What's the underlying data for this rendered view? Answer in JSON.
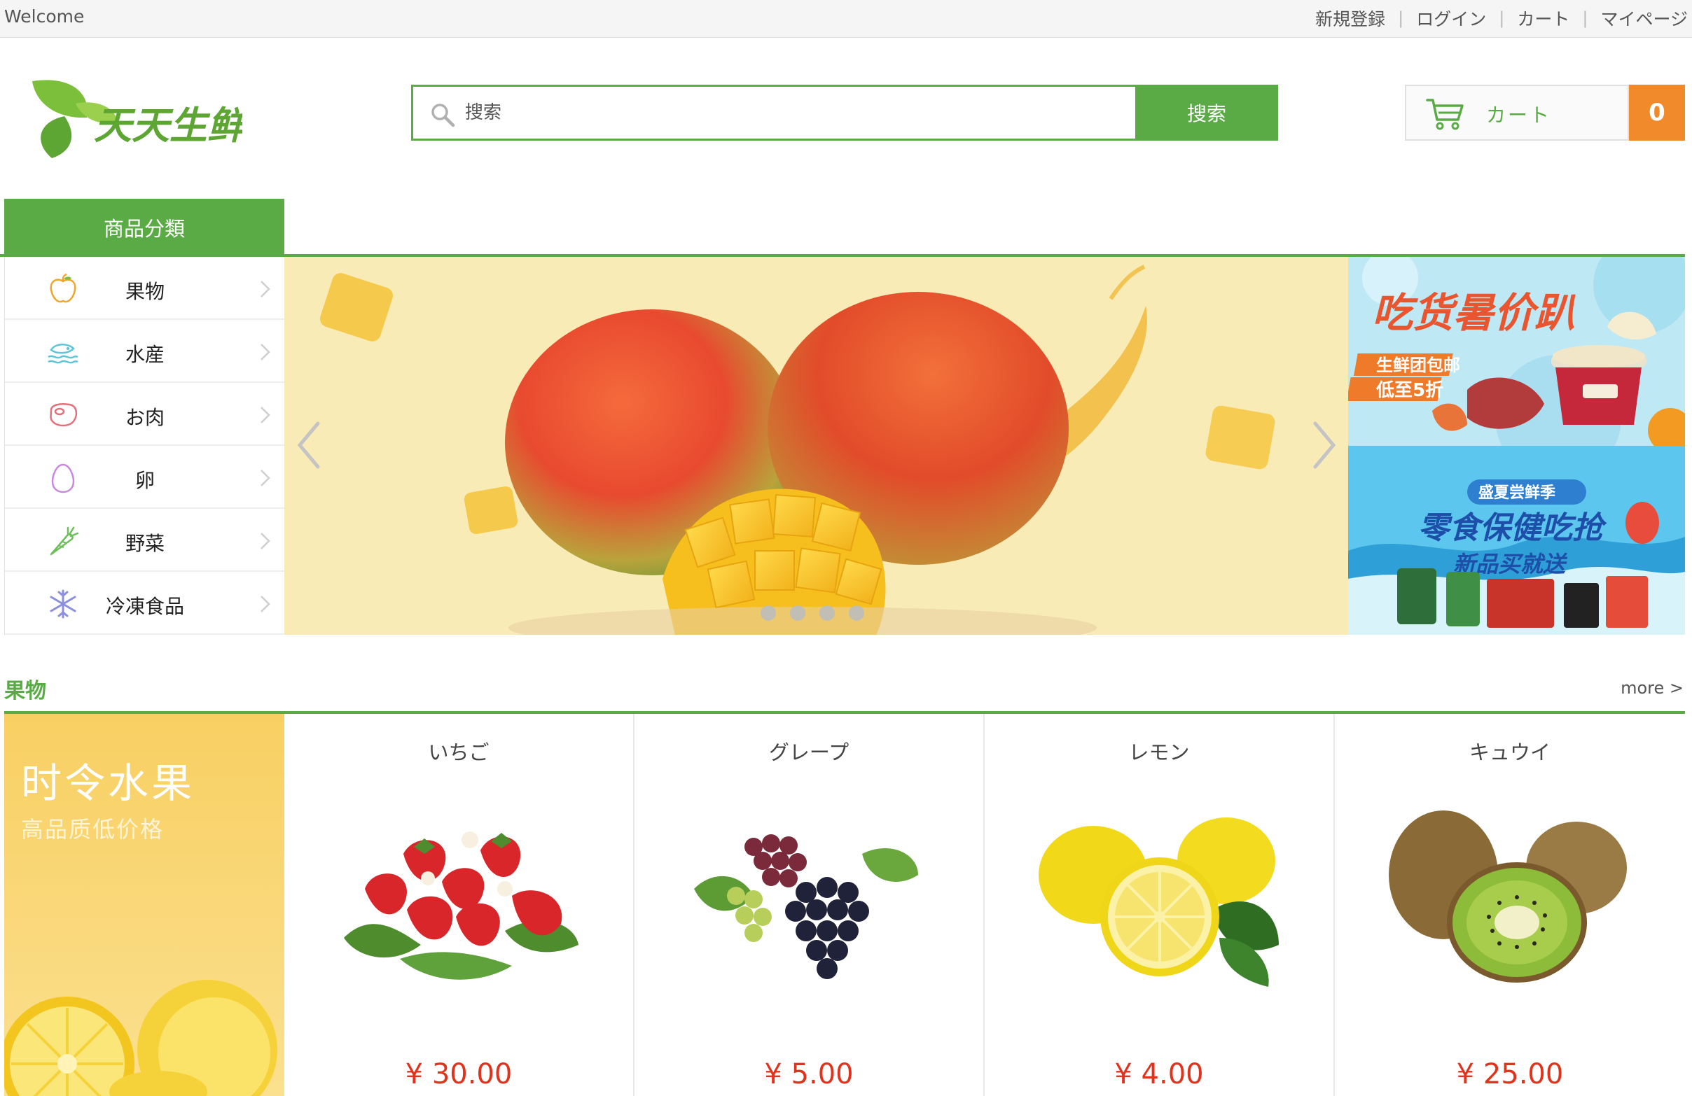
{
  "topbar": {
    "welcome": "Welcome",
    "links": [
      "新規登録",
      "ログイン",
      "カート",
      "マイページ"
    ]
  },
  "logo": {
    "text": "天天生鲜"
  },
  "search": {
    "placeholder": "搜索",
    "button_label": "搜索"
  },
  "cart": {
    "label": "カート",
    "count": "0"
  },
  "category_header": "商品分類",
  "categories": [
    {
      "label": "果物",
      "icon": "apple-icon"
    },
    {
      "label": "水産",
      "icon": "fish-icon"
    },
    {
      "label": "お肉",
      "icon": "meat-icon"
    },
    {
      "label": "卵",
      "icon": "egg-icon"
    },
    {
      "label": "野菜",
      "icon": "carrot-icon"
    },
    {
      "label": "冷凍食品",
      "icon": "snowflake-icon"
    }
  ],
  "banner": {
    "slide_count": 4
  },
  "promos": [
    {
      "title": "吃货暑价趴",
      "line1": "生鲜团包邮",
      "line2": "低至5折"
    },
    {
      "tag": "盛夏尝鲜季",
      "title": "零食保健吃抢",
      "subtitle": "新品买就送"
    }
  ],
  "section": {
    "title": "果物",
    "more": "more >",
    "feature": {
      "title": "时令水果",
      "subtitle": "高品质低价格"
    },
    "products": [
      {
        "name": "いちご",
        "price": "¥ 30.00",
        "image": "strawberry-image"
      },
      {
        "name": "グレープ",
        "price": "¥ 5.00",
        "image": "grape-image"
      },
      {
        "name": "レモン",
        "price": "¥ 4.00",
        "image": "lemon-image"
      },
      {
        "name": "キュウイ",
        "price": "¥ 25.00",
        "image": "kiwi-image"
      }
    ]
  },
  "colors": {
    "brand_green": "#5aab46",
    "cart_orange": "#f08a2a",
    "price_red": "#e0321c"
  }
}
